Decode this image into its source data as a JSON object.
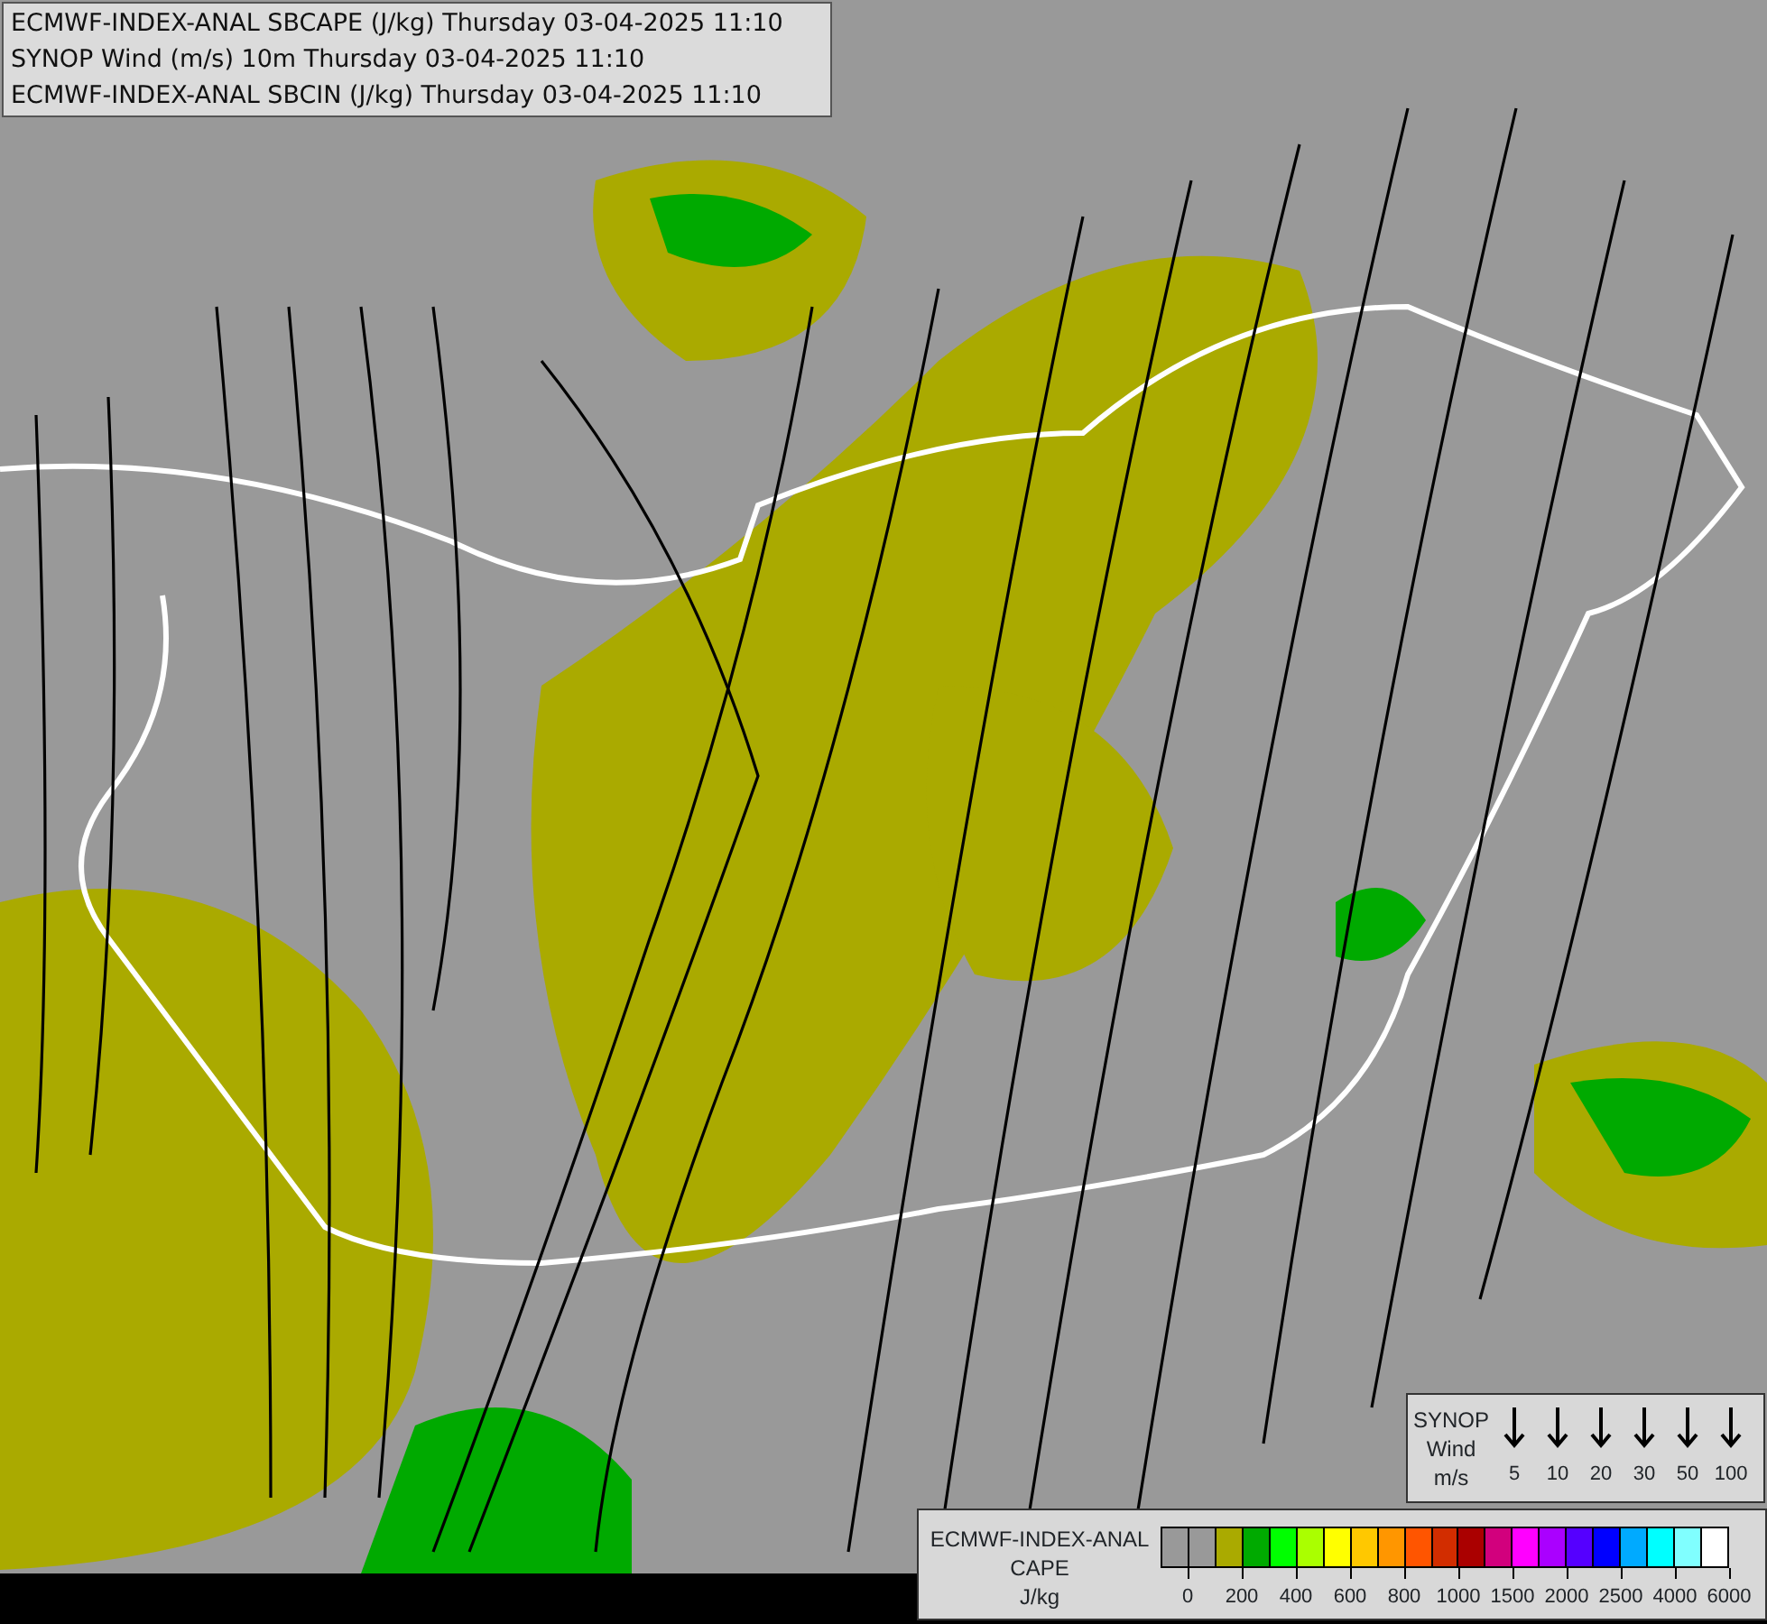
{
  "title_lines": [
    "ECMWF-INDEX-ANAL SBCAPE (J/kg) Thursday 03-04-2025 11:10",
    "SYNOP Wind (m/s) 10m Thursday 03-04-2025 11:10",
    "ECMWF-INDEX-ANAL SBCIN (J/kg) Thursday 03-04-2025 11:10"
  ],
  "wind_legend": {
    "label_lines": [
      "SYNOP",
      "Wind",
      "m/s"
    ],
    "items": [
      {
        "label": "5"
      },
      {
        "label": "10"
      },
      {
        "label": "20"
      },
      {
        "label": "30"
      },
      {
        "label": "50"
      },
      {
        "label": "100"
      }
    ]
  },
  "cape_legend": {
    "label_lines": [
      "ECMWF-INDEX-ANAL",
      "CAPE",
      "J/kg"
    ],
    "swatches": [
      {
        "color": "#999999"
      },
      {
        "color": "#999999"
      },
      {
        "color": "#aaaa00"
      },
      {
        "color": "#00aa00"
      },
      {
        "color": "#00ff00"
      },
      {
        "color": "#aaff00"
      },
      {
        "color": "#ffff00"
      },
      {
        "color": "#ffc800"
      },
      {
        "color": "#ff9600"
      },
      {
        "color": "#ff5500"
      },
      {
        "color": "#d22d00"
      },
      {
        "color": "#aa0000"
      },
      {
        "color": "#d2007d"
      },
      {
        "color": "#ff00ff"
      },
      {
        "color": "#aa00ff"
      },
      {
        "color": "#5500ff"
      },
      {
        "color": "#0000ff"
      },
      {
        "color": "#00aaff"
      },
      {
        "color": "#00ffff"
      },
      {
        "color": "#80ffff"
      },
      {
        "color": "#ffffff"
      }
    ],
    "tick_labels": [
      "0",
      "200",
      "400",
      "600",
      "800",
      "1000",
      "1500",
      "2000",
      "2500",
      "4000",
      "6000"
    ]
  }
}
